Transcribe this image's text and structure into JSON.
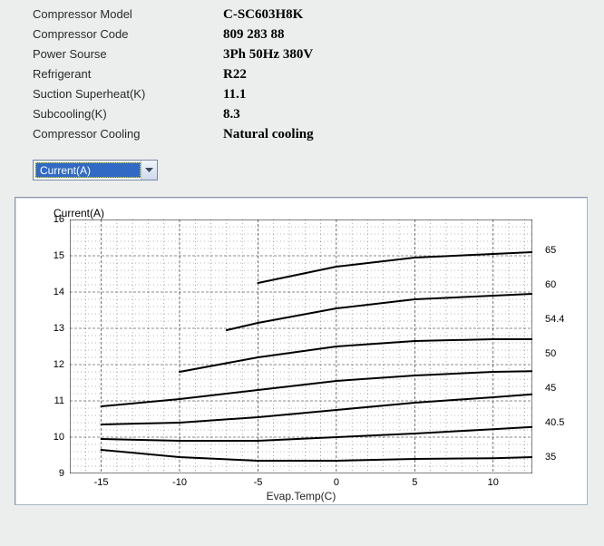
{
  "specs": {
    "rows": [
      {
        "label": "Compressor Model",
        "value": "C-SC603H8K"
      },
      {
        "label": "Compressor Code",
        "value": "809 283 88"
      },
      {
        "label": "Power Sourse",
        "value": "3Ph  50Hz  380V"
      },
      {
        "label": "Refrigerant",
        "value": "R22"
      },
      {
        "label": "Suction Superheat(K)",
        "value": "11.1"
      },
      {
        "label": "Subcooling(K)",
        "value": "8.3"
      },
      {
        "label": "Compressor Cooling",
        "value": "Natural cooling"
      }
    ]
  },
  "dropdown": {
    "selected": "Current(A)"
  },
  "chart_data": {
    "type": "line",
    "title": "Current(A)",
    "xlabel": "Evap.Temp(C)",
    "ylabel": "",
    "xlim": [
      -17,
      12.5
    ],
    "ylim": [
      9,
      16
    ],
    "x_ticks": [
      -15,
      -10,
      -5,
      0,
      5,
      10
    ],
    "y_ticks": [
      9,
      10,
      11,
      12,
      13,
      14,
      15,
      16
    ],
    "x": [
      -15,
      -10,
      -5,
      0,
      5,
      10,
      12.5
    ],
    "series": [
      {
        "name": "65",
        "x": [
          -5,
          0,
          5,
          10,
          12.5
        ],
        "values": [
          14.25,
          14.7,
          14.95,
          15.05,
          15.1
        ]
      },
      {
        "name": "60",
        "x": [
          -7,
          -5,
          0,
          5,
          10,
          12.5
        ],
        "values": [
          12.95,
          13.15,
          13.55,
          13.8,
          13.9,
          13.95
        ]
      },
      {
        "name": "54.4",
        "x": [
          -10,
          -5,
          0,
          5,
          10,
          12.5
        ],
        "values": [
          11.8,
          12.2,
          12.5,
          12.65,
          12.7,
          12.7
        ]
      },
      {
        "name": "50",
        "values": [
          10.85,
          11.05,
          11.3,
          11.55,
          11.7,
          11.8,
          11.82
        ]
      },
      {
        "name": "45",
        "values": [
          10.35,
          10.4,
          10.55,
          10.75,
          10.95,
          11.1,
          11.18
        ]
      },
      {
        "name": "40.5",
        "values": [
          9.95,
          9.9,
          9.9,
          10.0,
          10.1,
          10.22,
          10.28
        ]
      },
      {
        "name": "35",
        "values": [
          9.65,
          9.45,
          9.35,
          9.35,
          9.4,
          9.42,
          9.45
        ]
      }
    ]
  }
}
